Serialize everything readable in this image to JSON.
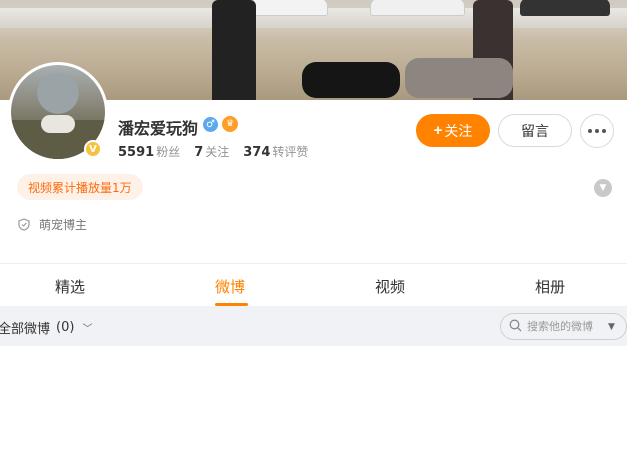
{
  "profile": {
    "name": "潘宏爱玩狗",
    "verified_badge": "V",
    "stats": [
      {
        "value": "5591",
        "label": "粉丝"
      },
      {
        "value": "7",
        "label": "关注"
      },
      {
        "value": "374",
        "label": "转评赞"
      }
    ],
    "play_tag": "视频累计播放量1万",
    "role": "萌宠博主"
  },
  "actions": {
    "follow_plus": "+",
    "follow_label": "关注",
    "message_label": "留言"
  },
  "tabs": [
    {
      "label": "精选"
    },
    {
      "label": "微博"
    },
    {
      "label": "视频"
    },
    {
      "label": "相册"
    }
  ],
  "filter": {
    "label": "全部微博",
    "count": "(0)",
    "search_placeholder": "搜索他的微博"
  },
  "icons": {
    "gender": "male-icon",
    "crown": "crown-icon",
    "expand": "chevron-down-icon",
    "role": "shield-icon",
    "search": "search-icon"
  },
  "colors": {
    "accent": "#ff8200",
    "tag_bg": "#fef1e8",
    "tag_text": "#ff6b0a",
    "filter_bg": "#f1f2f5"
  }
}
